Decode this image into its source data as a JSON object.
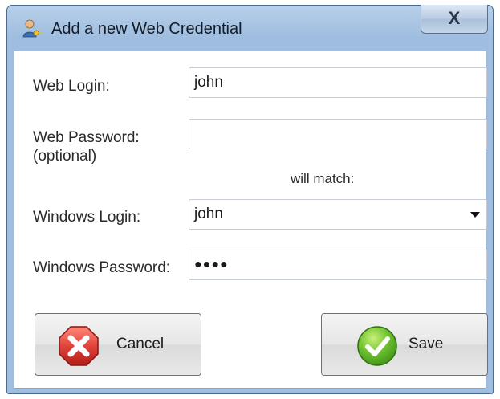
{
  "window": {
    "title": "Add a new Web Credential",
    "close_glyph": "X"
  },
  "icons": {
    "title_icon": "user-key-icon",
    "cancel_icon": "red-x-icon",
    "save_icon": "green-check-icon"
  },
  "form": {
    "web_login_label": "Web Login:",
    "web_login_value": "john",
    "web_password_label": "Web Password:",
    "web_password_hint": "(optional)",
    "web_password_value": "",
    "match_text": "will match:",
    "windows_login_label": "Windows Login:",
    "windows_login_value": "john",
    "windows_password_label": "Windows Password:",
    "windows_password_value": "●●●●"
  },
  "buttons": {
    "cancel": "Cancel",
    "save": "Save"
  },
  "colors": {
    "title_bar": "#b7d0ea",
    "cancel_red": "#e0443a",
    "save_green": "#5cb82a"
  }
}
